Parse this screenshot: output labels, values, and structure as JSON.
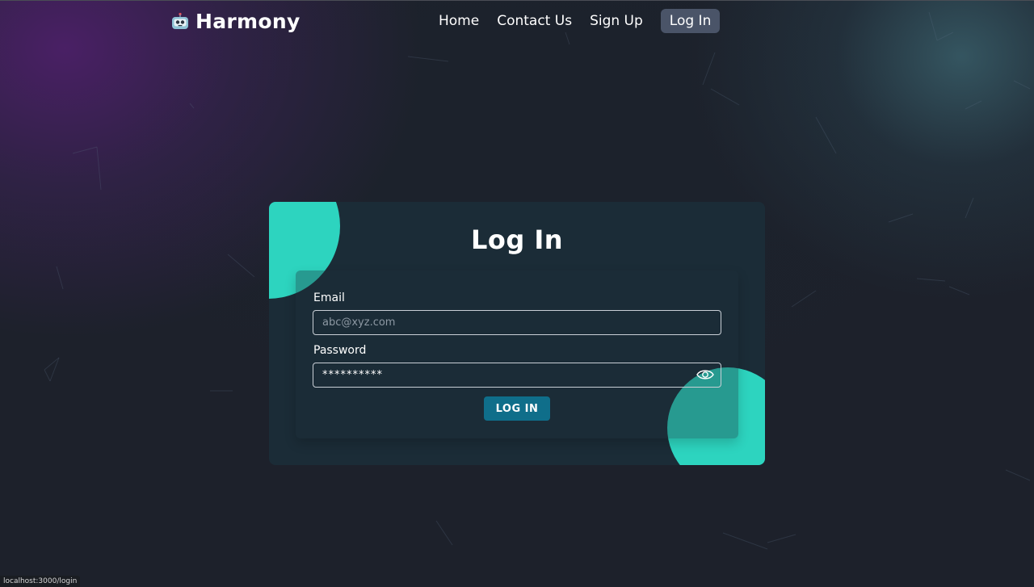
{
  "header": {
    "brand_name": "Harmony",
    "brand_icon": "robot-icon",
    "nav": [
      {
        "label": "Home"
      },
      {
        "label": "Contact Us"
      },
      {
        "label": "Sign Up"
      },
      {
        "label": "Log In",
        "active": true
      }
    ]
  },
  "login_form": {
    "title": "Log In",
    "email_label": "Email",
    "email_placeholder": "abc@xyz.com",
    "email_value": "",
    "password_label": "Password",
    "password_value": "**********",
    "password_toggle_icon": "eye-icon",
    "submit_label": "LOG IN"
  },
  "status_bar": {
    "url": "localhost:3000/login"
  },
  "colors": {
    "accent_teal": "#2dd4bf",
    "button": "#0f6e8a",
    "card": "#1b2c37",
    "active_nav": "#4a5468",
    "background": "#1d212b",
    "purple_glow": "#4c2068"
  }
}
